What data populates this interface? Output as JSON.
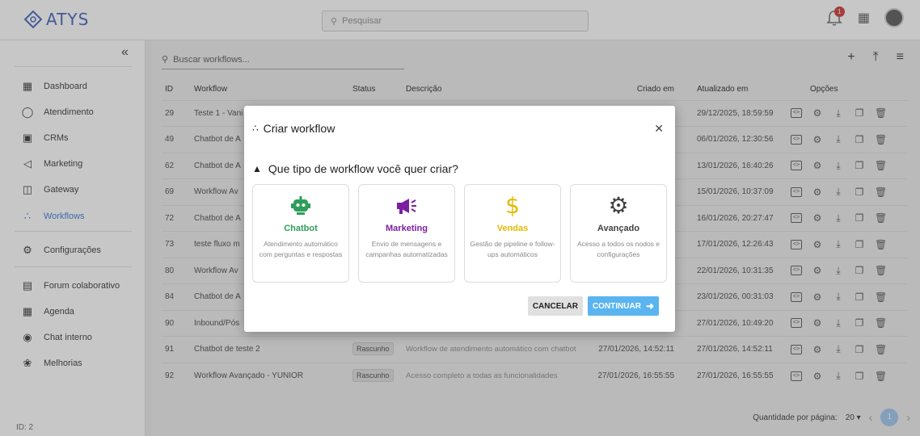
{
  "topbar": {
    "logo_text": "ATYS",
    "search_placeholder": "Pesquisar",
    "notification_count": "1"
  },
  "sidebar": {
    "collapse_glyph": "«",
    "items": [
      {
        "label": "Dashboard",
        "icon": "dashboard-icon"
      },
      {
        "label": "Atendimento",
        "icon": "chat-bubble-icon"
      },
      {
        "label": "CRMs",
        "icon": "kanban-icon"
      },
      {
        "label": "Marketing",
        "icon": "megaphone-icon"
      },
      {
        "label": "Gateway",
        "icon": "gateway-icon"
      },
      {
        "label": "Workflows",
        "icon": "workflow-icon"
      },
      {
        "label": "Configurações",
        "icon": "gear-icon"
      },
      {
        "label": "Forum colaborativo",
        "icon": "forum-icon"
      },
      {
        "label": "Agenda",
        "icon": "calendar-icon"
      },
      {
        "label": "Chat interno",
        "icon": "chat-icon"
      },
      {
        "label": "Melhorias",
        "icon": "bug-icon"
      }
    ],
    "user_id": "ID: 2"
  },
  "main": {
    "search_placeholder": "Buscar workflows...",
    "columns": [
      "ID",
      "Workflow",
      "Status",
      "Descrição",
      "Criado em",
      "Atualizado em",
      "Opções"
    ],
    "rows": [
      {
        "id": "29",
        "name": "Teste 1 - Vani",
        "status": "",
        "desc": "",
        "created": "",
        "updated": "29/12/2025, 18:59:59"
      },
      {
        "id": "49",
        "name": "Chatbot de A",
        "status": "",
        "desc": "",
        "created": "",
        "updated": "06/01/2026, 12:30:56"
      },
      {
        "id": "62",
        "name": "Chatbot de A",
        "status": "",
        "desc": "",
        "created": "",
        "updated": "13/01/2026, 16:40:26"
      },
      {
        "id": "69",
        "name": "Workflow Av",
        "status": "",
        "desc": "",
        "created": "",
        "updated": "15/01/2026, 10:37:09"
      },
      {
        "id": "72",
        "name": "Chatbot de A",
        "status": "",
        "desc": "",
        "created": "",
        "updated": "16/01/2026, 20:27:47"
      },
      {
        "id": "73",
        "name": "teste fluxo m",
        "status": "",
        "desc": "",
        "created": "",
        "updated": "17/01/2026, 12:26:43"
      },
      {
        "id": "80",
        "name": "Workflow Av",
        "status": "",
        "desc": "",
        "created": "",
        "updated": "22/01/2026, 10:31:35"
      },
      {
        "id": "84",
        "name": "Chatbot de A",
        "status": "",
        "desc": "",
        "created": "",
        "updated": "23/01/2026, 00:31:03"
      },
      {
        "id": "90",
        "name": "Inbound/Pós",
        "status": "",
        "desc": "",
        "created": "",
        "updated": "27/01/2026, 10:49:20"
      },
      {
        "id": "91",
        "name": "Chatbot de teste 2",
        "status": "Rascunho",
        "desc": "Workflow de atendimento automático com chatbot",
        "created": "27/01/2026, 14:52:11",
        "updated": "27/01/2026, 14:52:11"
      },
      {
        "id": "92",
        "name": "Workflow Avançado - YUNIOR",
        "status": "Rascunho",
        "desc": "Acesso completo a todas as funcionalidades",
        "created": "27/01/2026, 16:55:55",
        "updated": "27/01/2026, 16:55:55"
      }
    ],
    "pager": {
      "label": "Quantidade por página:",
      "per_page": "20",
      "current_page": "1"
    }
  },
  "modal": {
    "title": "Criar workflow",
    "question": "Que tipo de workflow você quer criar?",
    "cards": [
      {
        "title": "Chatbot",
        "desc": "Atendimento automático com perguntas e respostas",
        "color": "#2e9e5b",
        "icon": "robot-icon"
      },
      {
        "title": "Marketing",
        "desc": "Envio de mensagens e campanhas automatizadas",
        "color": "#7b1fa2",
        "icon": "megaphone-icon"
      },
      {
        "title": "Vendas",
        "desc": "Gestão de pipeline e follow-ups automáticos",
        "color": "#e6b800",
        "icon": "dollar-icon"
      },
      {
        "title": "Avançado",
        "desc": "Acesso a todos os nodos e configurações",
        "color": "#424242",
        "icon": "gear-icon"
      }
    ],
    "cancel_label": "CANCELAR",
    "continue_label": "CONTINUAR"
  }
}
